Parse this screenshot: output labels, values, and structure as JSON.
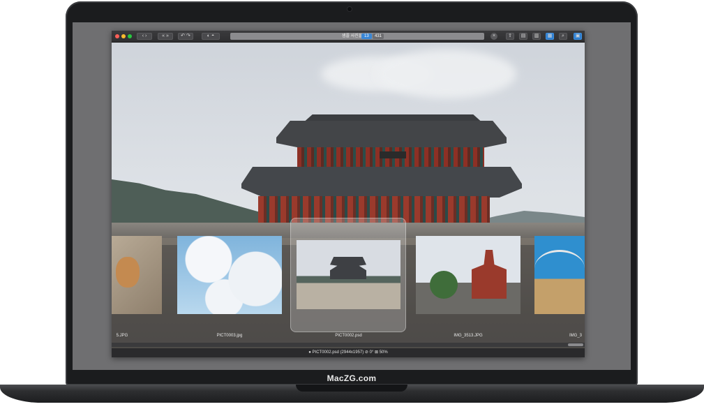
{
  "toolbar": {
    "title_text": "샘플 사진들",
    "index": "13",
    "total": "431"
  },
  "filmstrip": {
    "captions": [
      "5.JPG",
      "PICT0003.jpg",
      "PICT0002.psd",
      "IMG_3513.JPG",
      "IMG_3"
    ]
  },
  "statusbar": {
    "text": "● PICT0002.psd (2944x1957) ⊘ 0° ⊠ 50%"
  },
  "watermark": "MacZG.com",
  "colors": {
    "accent": "#2f7fd0",
    "traffic_red": "#ff5f57",
    "traffic_yellow": "#febc2e",
    "traffic_green": "#28c840"
  }
}
